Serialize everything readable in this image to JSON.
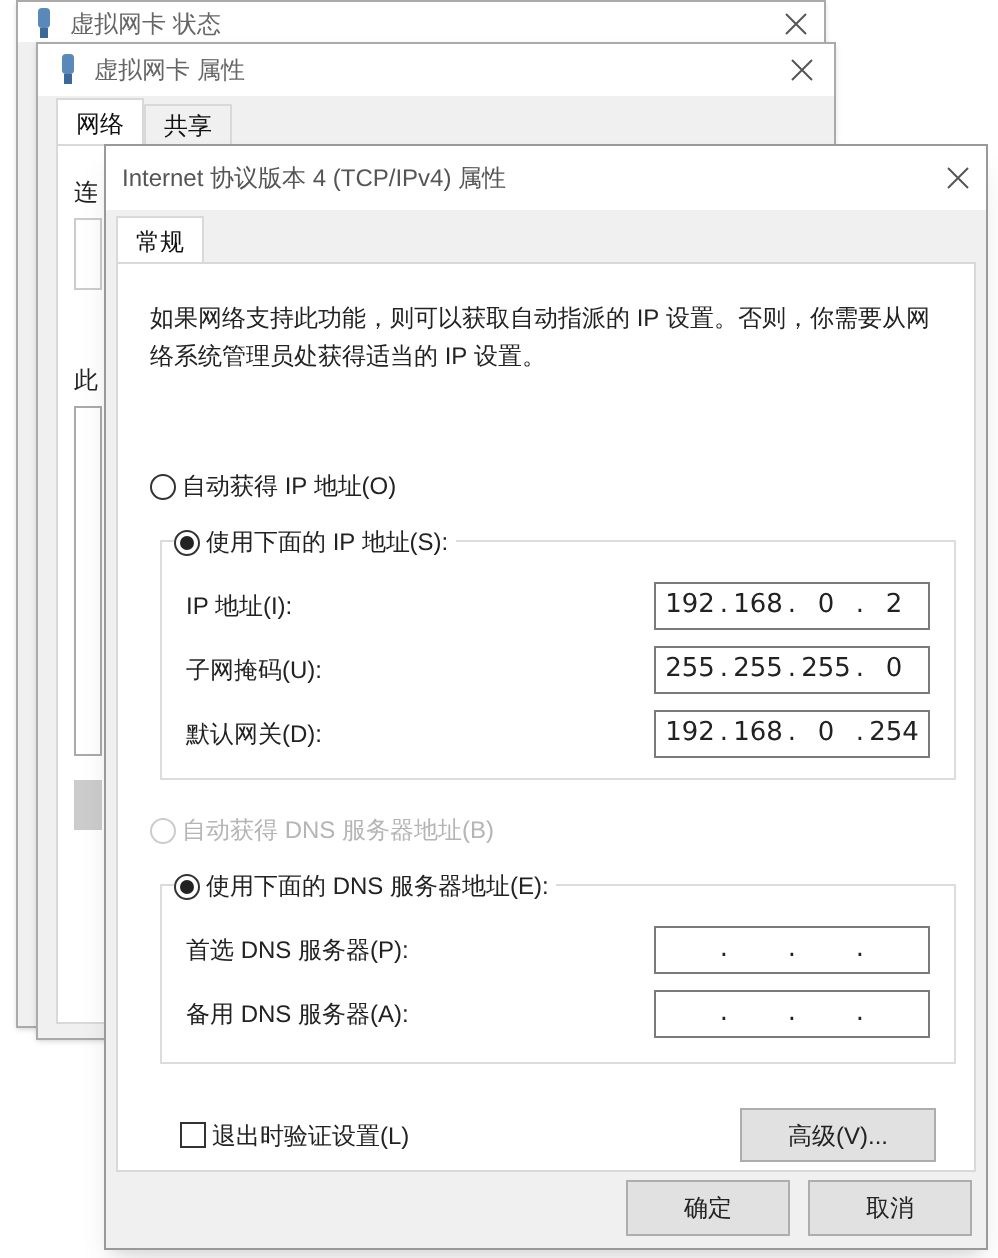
{
  "back_windows": [
    {
      "title": "虚拟网卡 状态"
    },
    {
      "title": "虚拟网卡 属性",
      "tabs": [
        {
          "label": "网络",
          "selected": true
        },
        {
          "label": "共享",
          "selected": false
        }
      ],
      "cut_labels": [
        "连",
        "此"
      ]
    }
  ],
  "dialog": {
    "title": "Internet 协议版本 4 (TCP/IPv4) 属性",
    "tabs": [
      {
        "label": "常规",
        "selected": true
      }
    ],
    "description": "如果网络支持此功能，则可以获取自动指派的 IP 设置。否则，你需要从网络系统管理员处获得适当的 IP 设置。",
    "ip_auto": {
      "label": "自动获得 IP 地址(O)",
      "selected": false,
      "disabled": false
    },
    "ip_manual": {
      "label": "使用下面的 IP 地址(S):",
      "selected": true,
      "disabled": false
    },
    "ip_fields": [
      {
        "label": "IP 地址(I):",
        "octets": [
          "192",
          "168",
          "0",
          "2"
        ],
        "dots": [
          ".",
          ".",
          "."
        ]
      },
      {
        "label": "子网掩码(U):",
        "octets": [
          "255",
          "255",
          "255",
          "0"
        ],
        "dots": [
          ".",
          ".",
          "."
        ]
      },
      {
        "label": "默认网关(D):",
        "octets": [
          "192",
          "168",
          "0",
          "254"
        ],
        "dots": [
          ".",
          ".",
          "."
        ]
      }
    ],
    "dns_auto": {
      "label": "自动获得 DNS 服务器地址(B)",
      "selected": false,
      "disabled": true
    },
    "dns_manual": {
      "label": "使用下面的 DNS 服务器地址(E):",
      "selected": true,
      "disabled": false
    },
    "dns_fields": [
      {
        "label": "首选 DNS 服务器(P):",
        "dots": [
          ".",
          ".",
          "."
        ]
      },
      {
        "label": "备用 DNS 服务器(A):",
        "dots": [
          ".",
          ".",
          "."
        ]
      }
    ],
    "validate": {
      "label": "退出时验证设置(L)",
      "checked": false
    },
    "advanced_button": "高级(V)...",
    "buttons": [
      "确定",
      "取消"
    ]
  }
}
